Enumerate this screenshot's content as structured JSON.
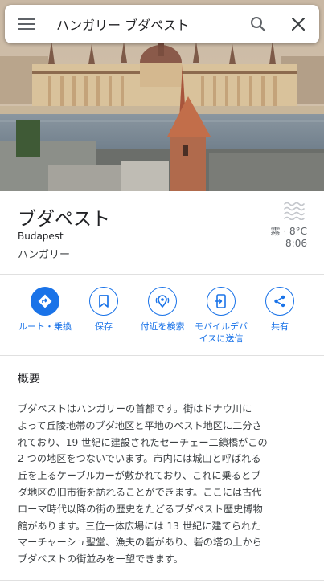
{
  "search": {
    "query": "ハンガリー ブダペスト",
    "menu_icon": "menu-icon",
    "search_icon": "search-icon",
    "close_icon": "close-icon"
  },
  "place": {
    "name": "ブダペスト",
    "latin_name": "Budapest",
    "country": "ハンガリー"
  },
  "weather": {
    "icon": "fog-icon",
    "condition_temp": "霧 · 8°C",
    "time": "8:06"
  },
  "actions": [
    {
      "label": "ルート・乗換",
      "icon": "directions-icon"
    },
    {
      "label": "保存",
      "icon": "bookmark-icon"
    },
    {
      "label": "付近を検索",
      "icon": "nearby-icon"
    },
    {
      "label": "モバイルデバ\nイスに送信",
      "icon": "send-to-phone-icon"
    },
    {
      "label": "共有",
      "icon": "share-icon"
    }
  ],
  "overview": {
    "heading": "概要",
    "body": "ブダペストはハンガリーの首都です。街はドナウ川に\nよって丘陵地帯のブダ地区と平地のペスト地区に二分さ\nれており、19 世紀に建設されたセーチェー二鎖橋がこの\n2 つの地区をつないでいます。市内には城山と呼ばれる\n丘を上るケーブルカーが敷かれており、これに乗るとブ\nダ地区の旧市街を訪れることができます。ここには古代\nローマ時代以降の街の歴史をたどるブダペスト歴史博物\n館があります。三位一体広場には 13 世紀に建てられた\nマーチャーシュ聖堂、漁夫の砦があり、砦の塔の上から\nブダペストの街並みを一望できます。"
  },
  "colors": {
    "accent": "#1a73e8",
    "text": "#202124",
    "secondary": "#5f6368"
  }
}
